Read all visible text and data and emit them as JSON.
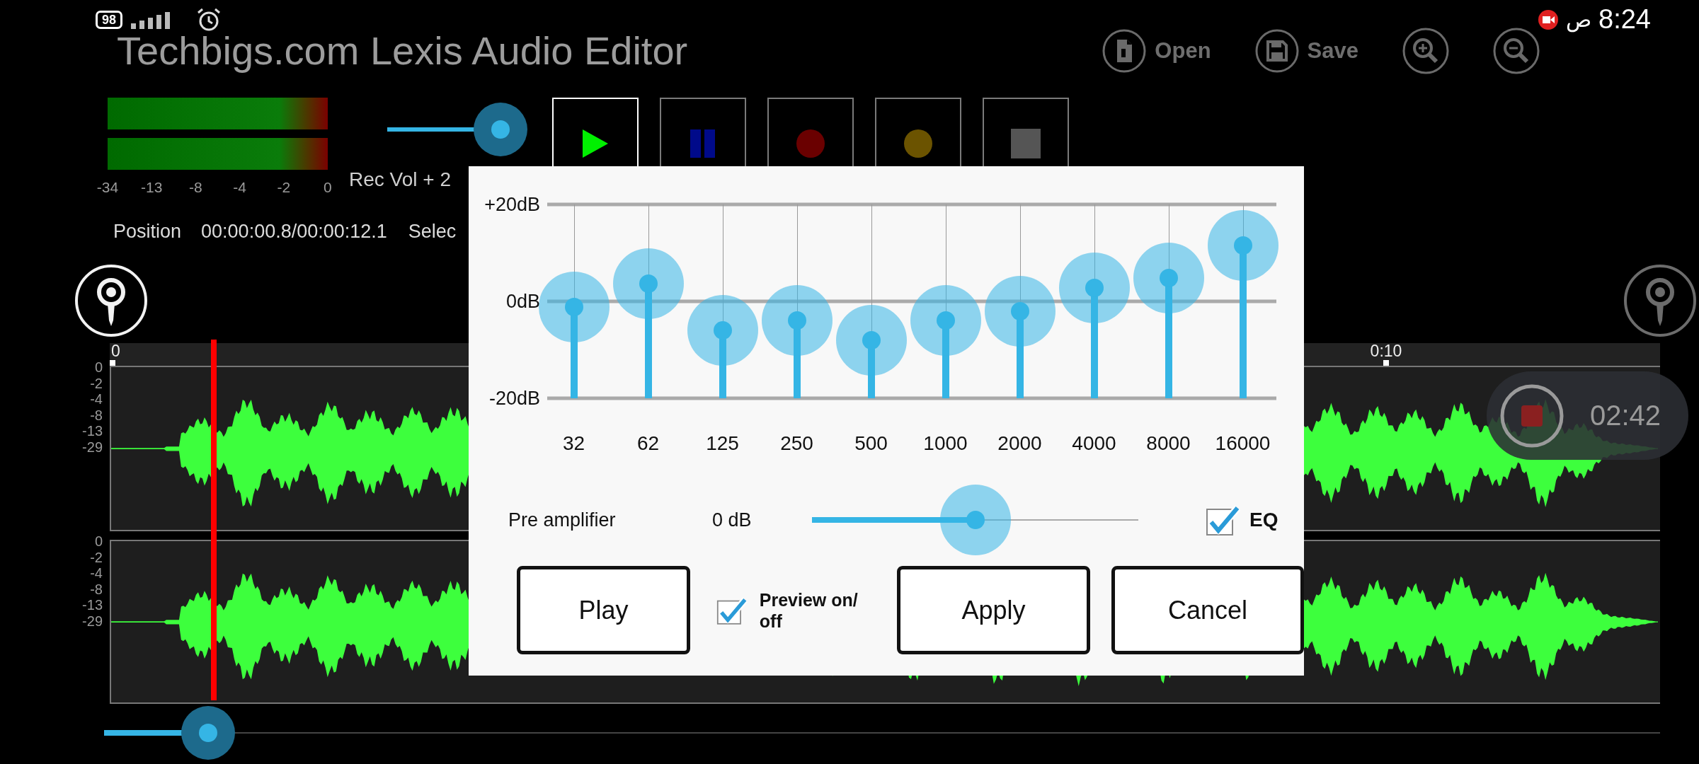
{
  "status_bar": {
    "battery": "98",
    "clock_prefix": "ص",
    "clock": "8:24"
  },
  "app_bar": {
    "title": "Techbigs.com Lexis Audio Editor",
    "actions": [
      {
        "kind": "open",
        "label": "Open"
      },
      {
        "kind": "save",
        "label": "Save"
      },
      {
        "kind": "zoom_in"
      },
      {
        "kind": "zoom_out"
      }
    ]
  },
  "level_meter": {
    "scale": [
      "-34",
      "-13",
      "-8",
      "-4",
      "-2",
      "0"
    ]
  },
  "rec_volume": {
    "level": 1,
    "label": "Rec Vol + 2"
  },
  "transport": [
    {
      "kind": "play",
      "selected": true
    },
    {
      "kind": "pause",
      "selected": false
    },
    {
      "kind": "record",
      "selected": false
    },
    {
      "kind": "record_pause",
      "selected": false
    },
    {
      "kind": "stop",
      "selected": false
    }
  ],
  "info": {
    "position_label": "Position",
    "position": "00:00:00.8/00:00:12.1",
    "selection_label": "Selec"
  },
  "timeline": {
    "ticks": [
      "0",
      "0:10"
    ],
    "channels": [
      {
        "scale": [
          "0",
          "-2",
          "-4",
          "-8",
          "-13",
          "-29"
        ]
      },
      {
        "scale": [
          "0",
          "-2",
          "-4",
          "-8",
          "-13",
          "-29"
        ]
      }
    ],
    "recording": {
      "time": "02:42"
    },
    "scroll": {
      "level": 0.067
    }
  },
  "equalizer": {
    "scale": [
      "+20dB",
      "0dB",
      "-20dB"
    ],
    "bands": [
      {
        "label": "32",
        "level": 0.47
      },
      {
        "label": "62",
        "level": 0.59
      },
      {
        "label": "125",
        "level": 0.35
      },
      {
        "label": "250",
        "level": 0.4
      },
      {
        "label": "500",
        "level": 0.3
      },
      {
        "label": "1000",
        "level": 0.4
      },
      {
        "label": "2000",
        "level": 0.45
      },
      {
        "label": "4000",
        "level": 0.57
      },
      {
        "label": "8000",
        "level": 0.62
      },
      {
        "label": "16000",
        "level": 0.79
      }
    ],
    "preamp": {
      "label": "Pre amplifier",
      "value": "0 dB",
      "level": 0.5
    },
    "eq": {
      "label": "EQ",
      "checked": true
    },
    "preview": {
      "label": "Preview on/ off",
      "checked": true
    },
    "buttons": [
      {
        "kind": "play",
        "label": "Play"
      },
      {
        "kind": "apply",
        "label": "Apply"
      },
      {
        "kind": "cancel",
        "label": "Cancel"
      }
    ]
  }
}
